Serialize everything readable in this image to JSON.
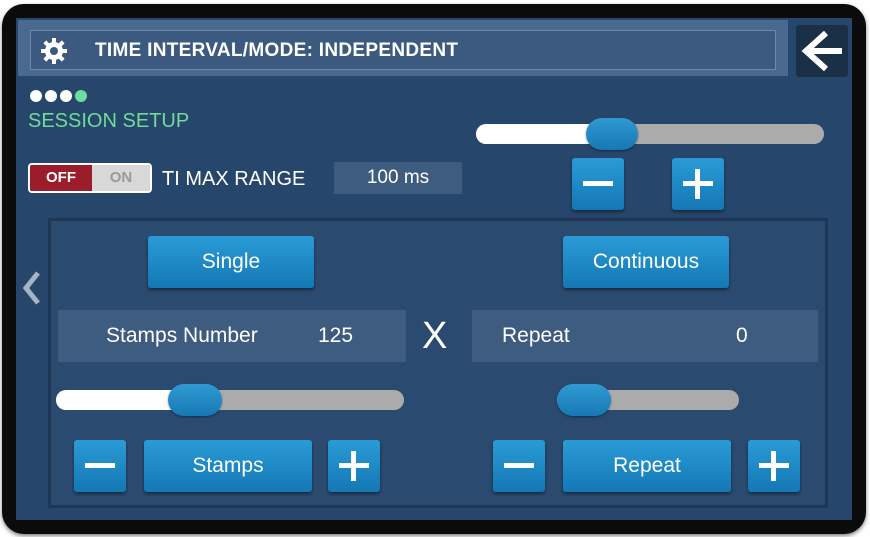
{
  "header": {
    "title": "TIME INTERVAL/MODE: INDEPENDENT",
    "settings_icon": "gear-icon",
    "back_icon": "arrow-left-icon"
  },
  "progress": {
    "total_steps": 4,
    "current_step": 4
  },
  "session": {
    "label": "SESSION SETUP"
  },
  "ti_max_range": {
    "toggle": {
      "off_label": "OFF",
      "on_label": "ON",
      "state": "OFF"
    },
    "label": "TI MAX RANGE",
    "value": "100 ms",
    "slider_fraction": 0.37
  },
  "nav": {
    "prev_icon": "chevron-left-icon"
  },
  "modes": {
    "single_label": "Single",
    "continuous_label": "Continuous"
  },
  "stamps": {
    "label": "Stamps Number",
    "value": "125",
    "slider_fraction": 0.38,
    "button_label": "Stamps"
  },
  "multiply": "X",
  "repeat": {
    "label": "Repeat",
    "value": "0",
    "slider_fraction": 0.0,
    "button_label": "Repeat"
  },
  "icons": {
    "minus": "minus-icon",
    "plus": "plus-icon"
  },
  "colors": {
    "screen_bg": "#27466c",
    "accent_green": "#6fdc9a",
    "button_blue": "#1f8ac8",
    "toggle_off": "#9b1c2a"
  }
}
